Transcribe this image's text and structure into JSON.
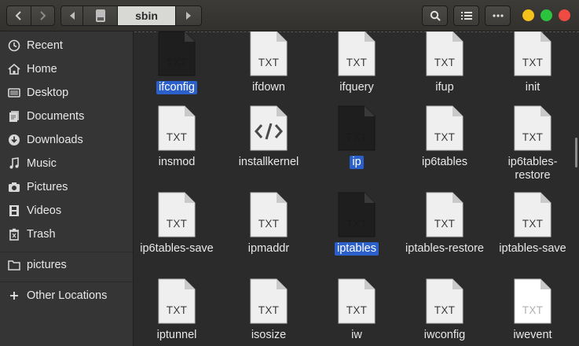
{
  "window": {
    "current_folder": "sbin"
  },
  "sidebar": {
    "items": [
      {
        "label": "Recent",
        "icon": "clock-icon"
      },
      {
        "label": "Home",
        "icon": "home-icon"
      },
      {
        "label": "Desktop",
        "icon": "desktop-icon"
      },
      {
        "label": "Documents",
        "icon": "documents-icon"
      },
      {
        "label": "Downloads",
        "icon": "downloads-icon"
      },
      {
        "label": "Music",
        "icon": "music-icon"
      },
      {
        "label": "Pictures",
        "icon": "camera-icon"
      },
      {
        "label": "Videos",
        "icon": "film-icon"
      },
      {
        "label": "Trash",
        "icon": "trash-icon"
      }
    ],
    "bookmarks": [
      {
        "label": "pictures",
        "icon": "folder-icon"
      }
    ],
    "other": {
      "label": "Other Locations",
      "icon": "plus-icon"
    }
  },
  "files": [
    {
      "name": "ifconfig",
      "icon": "txt",
      "variant": "dark",
      "selected": true
    },
    {
      "name": "ifdown",
      "icon": "txt",
      "variant": "light",
      "selected": false
    },
    {
      "name": "ifquery",
      "icon": "txt",
      "variant": "light",
      "selected": false
    },
    {
      "name": "ifup",
      "icon": "txt",
      "variant": "light",
      "selected": false
    },
    {
      "name": "init",
      "icon": "txt",
      "variant": "light",
      "selected": false
    },
    {
      "name": "insmod",
      "icon": "txt",
      "variant": "light",
      "selected": false
    },
    {
      "name": "installkernel",
      "icon": "code",
      "variant": "light",
      "selected": false
    },
    {
      "name": "ip",
      "icon": "txt",
      "variant": "dark",
      "selected": true
    },
    {
      "name": "ip6tables",
      "icon": "txt",
      "variant": "light",
      "selected": false
    },
    {
      "name": "ip6tables-restore",
      "icon": "txt",
      "variant": "light",
      "selected": false
    },
    {
      "name": "ip6tables-save",
      "icon": "txt",
      "variant": "light",
      "selected": false
    },
    {
      "name": "ipmaddr",
      "icon": "txt",
      "variant": "light",
      "selected": false
    },
    {
      "name": "iptables",
      "icon": "txt",
      "variant": "dark",
      "selected": true
    },
    {
      "name": "iptables-restore",
      "icon": "txt",
      "variant": "light",
      "selected": false
    },
    {
      "name": "iptables-save",
      "icon": "txt",
      "variant": "light",
      "selected": false
    },
    {
      "name": "iptunnel",
      "icon": "txt",
      "variant": "light",
      "selected": false
    },
    {
      "name": "isosize",
      "icon": "txt",
      "variant": "light",
      "selected": false
    },
    {
      "name": "iw",
      "icon": "txt",
      "variant": "light",
      "selected": false
    },
    {
      "name": "iwconfig",
      "icon": "txt",
      "variant": "light",
      "selected": false
    },
    {
      "name": "iwevent",
      "icon": "txt",
      "variant": "white",
      "selected": false
    }
  ],
  "icon_text": "TXT",
  "colors": {
    "selection": "#2b5fc9",
    "close": "#ef4b43",
    "maximize": "#2cc43e",
    "minimize": "#f4c21a"
  }
}
